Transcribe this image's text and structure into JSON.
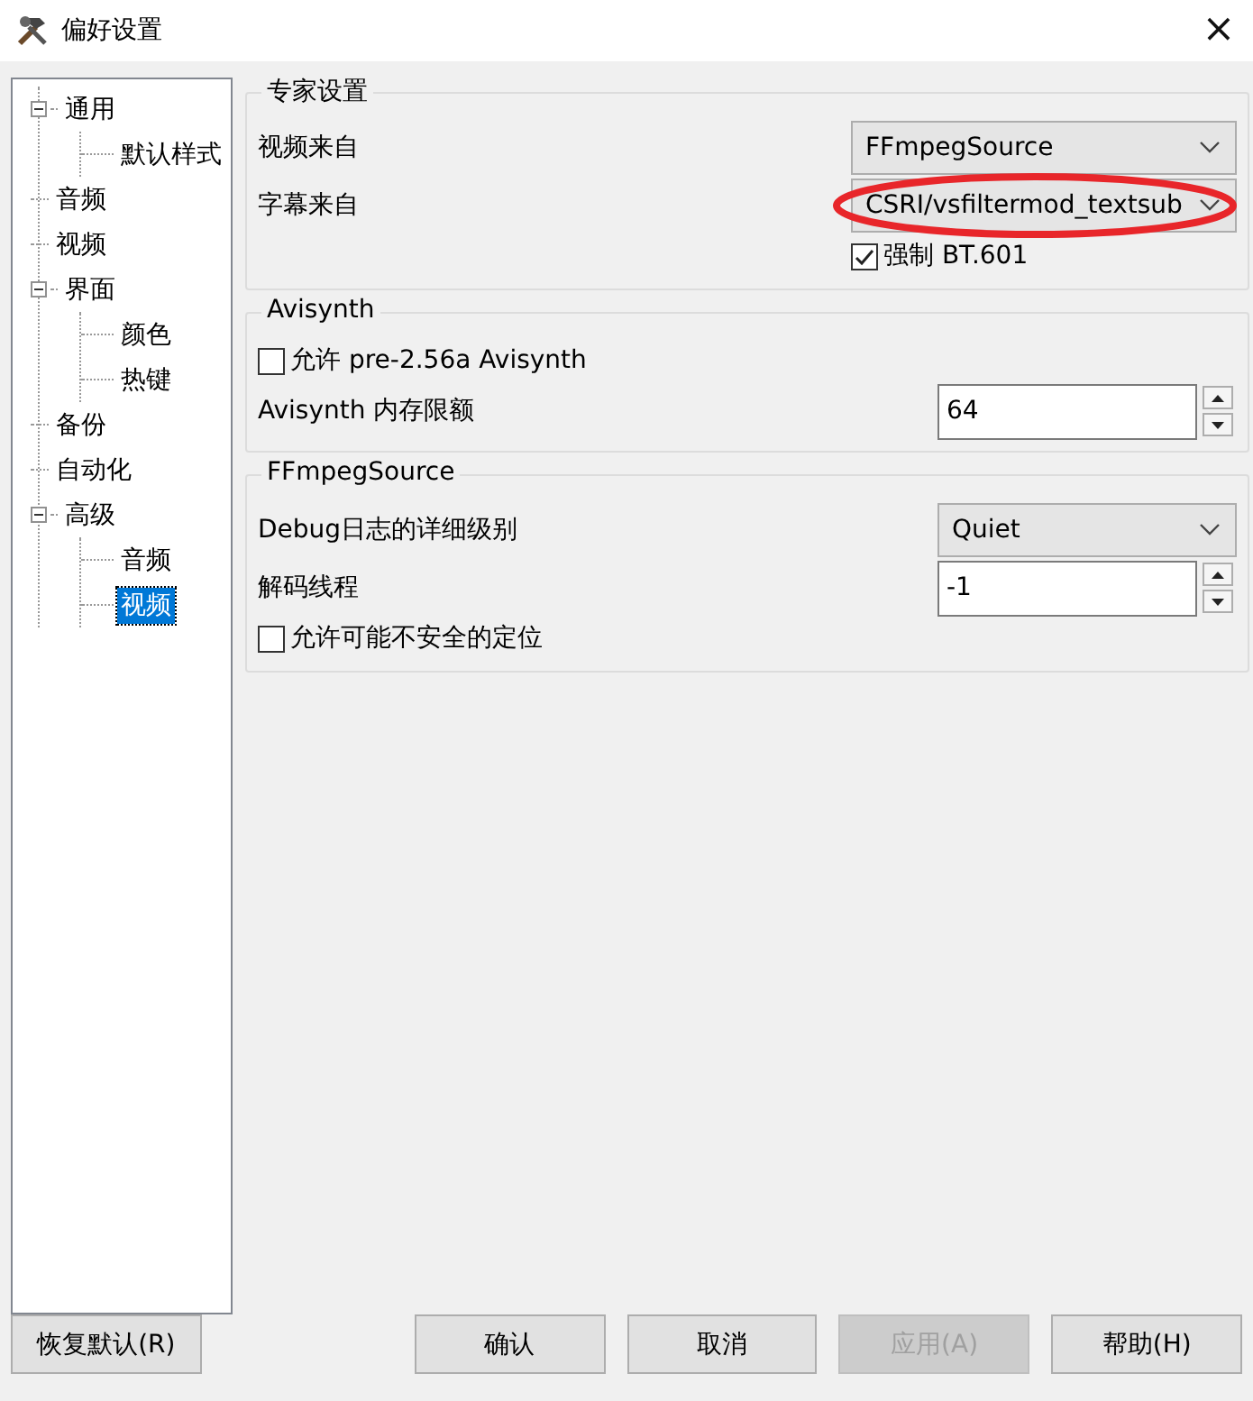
{
  "window": {
    "title": "偏好设置",
    "close": "×"
  },
  "tree": [
    {
      "label": "通用",
      "expanded": true,
      "selected": false,
      "children": [
        {
          "label": "默认样式",
          "selected": false
        }
      ]
    },
    {
      "label": "音频",
      "selected": false
    },
    {
      "label": "视频",
      "selected": false
    },
    {
      "label": "界面",
      "expanded": true,
      "selected": false,
      "children": [
        {
          "label": "颜色",
          "selected": false
        },
        {
          "label": "热键",
          "selected": false
        }
      ]
    },
    {
      "label": "备份",
      "selected": false
    },
    {
      "label": "自动化",
      "selected": false
    },
    {
      "label": "高级",
      "expanded": true,
      "selected": false,
      "children": [
        {
          "label": "音频",
          "selected": false
        },
        {
          "label": "视频",
          "selected": true
        }
      ]
    }
  ],
  "groups": [
    {
      "title": "专家设置",
      "rows": [
        {
          "kind": "select",
          "label": "视频来自",
          "value": "FFmpegSource",
          "circled": false
        },
        {
          "kind": "select",
          "label": "字幕来自",
          "value": "CSRI/vsfiltermod_textsub",
          "circled": true
        },
        {
          "kind": "sub-checkbox",
          "label": "强制 BT.601",
          "checked": true
        }
      ]
    },
    {
      "title": "Avisynth",
      "rows": [
        {
          "kind": "checkbox",
          "label": "允许 pre-2.56a Avisynth",
          "checked": false
        },
        {
          "kind": "spin",
          "label": "Avisynth 内存限额",
          "value": "64"
        }
      ]
    },
    {
      "title": "FFmpegSource",
      "rows": [
        {
          "kind": "select",
          "label": "Debug日志的详细级别",
          "value": "Quiet",
          "circled": false
        },
        {
          "kind": "spin",
          "label": "解码线程",
          "value": "-1"
        },
        {
          "kind": "checkbox",
          "label": "允许可能不安全的定位",
          "checked": false
        }
      ]
    }
  ],
  "buttons": [
    {
      "label": "恢复默认(R)",
      "disabled": false
    },
    {
      "label": "确认",
      "disabled": false
    },
    {
      "label": "取消",
      "disabled": false
    },
    {
      "label": "应用(A)",
      "disabled": true
    },
    {
      "label": "帮助(H)",
      "disabled": false
    }
  ]
}
